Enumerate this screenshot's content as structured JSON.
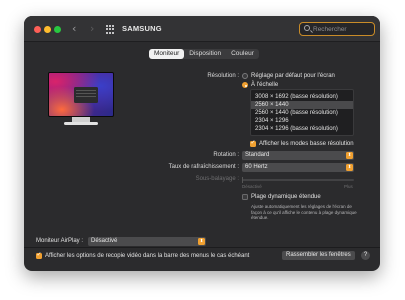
{
  "window": {
    "title": "SAMSUNG",
    "search_placeholder": "Rechercher",
    "search_value": ""
  },
  "tabs": [
    {
      "label": "Moniteur",
      "active": true
    },
    {
      "label": "Disposition",
      "active": false
    },
    {
      "label": "Couleur",
      "active": false
    }
  ],
  "resolution": {
    "label": "Résolution :",
    "option_default": "Réglage par défaut pour l'écran",
    "option_scaled": "À l'échelle",
    "selected_option": "À l'échelle",
    "list_items": [
      {
        "label": "3008 × 1692 (basse résolution)",
        "selected": false,
        "partial": false
      },
      {
        "label": "2560 × 1440",
        "selected": true,
        "partial": false
      },
      {
        "label": "2560 × 1440 (basse résolution)",
        "selected": false,
        "partial": false
      },
      {
        "label": "2304 × 1296",
        "selected": false,
        "partial": false
      },
      {
        "label": "2304 × 1296 (basse résolution)",
        "selected": false,
        "partial": false
      }
    ],
    "show_low_res_label": "Afficher les modes basse résolution",
    "show_low_res_checked": true
  },
  "rotation": {
    "label": "Rotation :",
    "value": "Standard"
  },
  "refresh": {
    "label": "Taux de rafraîchissement :",
    "value": "60 Hertz"
  },
  "underscan": {
    "label": "Sous-balayage :",
    "min_label": "Désactivé",
    "max_label": "Plus"
  },
  "dynamic_range": {
    "label": "Plage dynamique étendue",
    "checked": false,
    "description": "Ajuste automatiquement les réglages de l'écran de façon à ce qu'il affiche le contenu à plage dynamique étendue."
  },
  "airplay": {
    "label": "Moniteur AirPlay :",
    "value": "Désactivé"
  },
  "mirroring": {
    "label": "Afficher les options de recopie vidéo dans la barre des menus le cas échéant",
    "checked": true
  },
  "buttons": {
    "gather": "Rassembler les fenêtres",
    "help": "?"
  }
}
